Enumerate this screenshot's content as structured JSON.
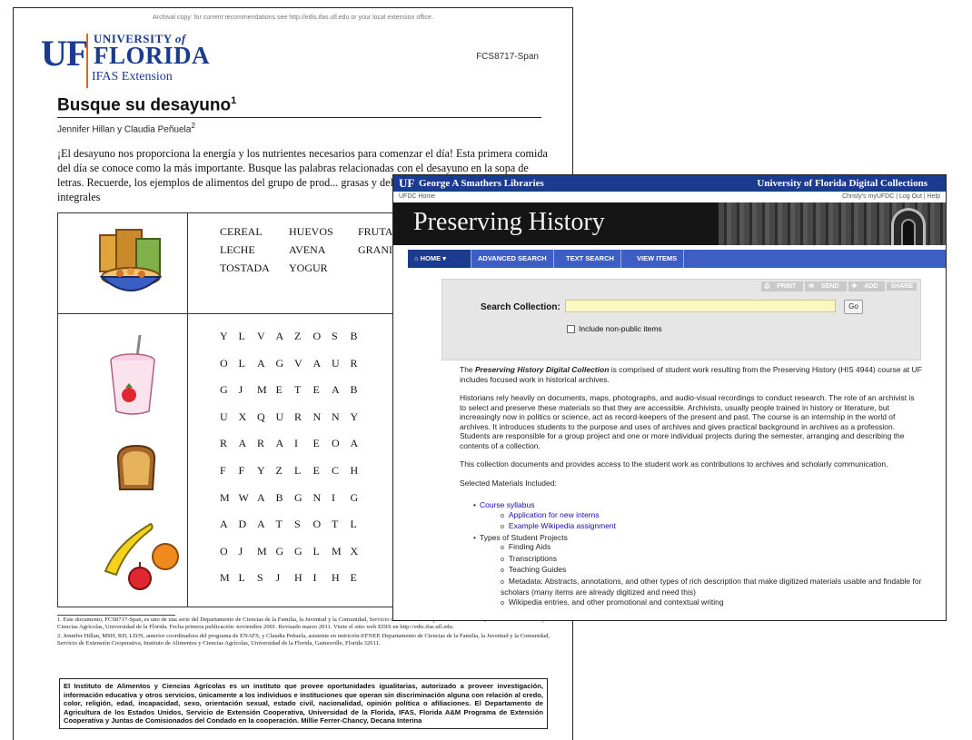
{
  "document": {
    "archival_note": "Archival copy: for current recommendations see http://edis.ifas.ufl.edu or your local extension office.",
    "logo": {
      "uf": "UF",
      "university_of": "UNIVERSITY",
      "of": "of",
      "florida": "FLORIDA",
      "ifas": "IFAS Extension"
    },
    "code": "FCS8717-Span",
    "title": "Busque su desayuno",
    "title_sup": "1",
    "authors": "Jennifer Hillan y Claudia Peñuela",
    "authors_sup": "2",
    "intro": "¡El desayuno nos proporciona la energía y los nutrientes necesarios para comenzar el día! Esta primera comida del día se conoce como la más importante. Busque las palabras relacionadas con el desayuno en la sopa de letras. Recuerde, los ejemplos de alimentos del grupo de prod... grasas y del grupo de granos, granos integrales",
    "words": [
      [
        "CEREAL",
        "HUEVOS",
        "FRUTAS"
      ],
      [
        "LECHE",
        "AVENA",
        "GRANIZ"
      ],
      [
        "TOSTADA",
        "YOGUR",
        ""
      ]
    ],
    "grid": [
      [
        "Y",
        "L",
        "V",
        "A",
        "Z",
        "O",
        "S",
        "B"
      ],
      [
        "O",
        "L",
        "A",
        "G",
        "V",
        "A",
        "U",
        "R"
      ],
      [
        "G",
        "J",
        "M",
        "E",
        "T",
        "E",
        "A",
        "B"
      ],
      [
        "U",
        "X",
        "Q",
        "U",
        "R",
        "N",
        "N",
        "Y"
      ],
      [
        "R",
        "A",
        "R",
        "A",
        "I",
        "E",
        "O",
        "A"
      ],
      [
        "F",
        "F",
        "Y",
        "Z",
        "L",
        "E",
        "C",
        "H"
      ],
      [
        "M",
        "W",
        "A",
        "B",
        "G",
        "N",
        "I",
        "G"
      ],
      [
        "A",
        "D",
        "A",
        "T",
        "S",
        "O",
        "T",
        "L"
      ],
      [
        "O",
        "J",
        "M",
        "G",
        "G",
        "L",
        "M",
        "X"
      ],
      [
        "M",
        "L",
        "S",
        "J",
        "H",
        "I",
        "H",
        "E"
      ]
    ],
    "footnote_1": "1. Este documento, FCS8717-Span, es uno de una serie del Departamento de Ciencias de la Familia, la Juventud y la Comunidad, Servicio de Extensión Cooperativa de la Florida, Instituto de Alimentos y Ciencias Agrícolas, Universidad de la Florida. Fecha primera publicación: noviembre 2001. Revisado marzo 2011. Visite el sitio web EDIS en http://edis.ifas.ufl.edu.",
    "footnote_2": "2. Jennifer Hillan, MSH, RD, LD/N, anterior coordinadora del programa de ENAFS, y Claudia Peñuela, asistente en nutrición-EFNEP, Departamento de Ciencias de la Familia, la Juventud y la Comunidad, Servicio de Extensión Cooperativa, Instituto de Alimentos y Ciencias Agrícolas, Universidad de la Florida, Gainesville, Florida 32611.",
    "ifas_notice": "El Instituto de Alimentos y Ciencias Agrícolas es un instituto que provee oportunidades igualitarias, autorizado a proveer investigación, información educativa y otros servicios, únicamente a los individuos e instituciones que operan sin discriminación alguna con relación al credo, color, religión, edad, incapacidad, sexo, orientación sexual, estado civil, nacionalidad, opinión política o afiliaciones. El Departamento de Agricultura de los Estados Unidos, Servicio de Extensión Cooperativa, Universidad de la Florida, IFAS, Florida A&M Programa de Extensión Cooperativa y Juntas de Comisionados del Condado en la cooperación. Millie Ferrer-Chancy, Decana Interina"
  },
  "browser": {
    "topbar": {
      "uf": "UF",
      "library": "George A Smathers Libraries",
      "collection": "University of Florida Digital Collections"
    },
    "subbar": {
      "home": "UFDC Home",
      "account": "Christy's myUFDC  |  Log Out  |  Help"
    },
    "banner_title": "Preserving History",
    "nav": {
      "home": "HOME",
      "advanced": "ADVANCED SEARCH",
      "text": "TEXT SEARCH",
      "view": "VIEW ITEMS"
    },
    "actions": {
      "print": "PRINT",
      "send": "SEND",
      "add": "ADD",
      "share": "SHARE"
    },
    "search": {
      "label": "Search Collection:",
      "value": "",
      "go": "Go",
      "checkbox_label": "Include non-public items"
    },
    "content": {
      "p1_lead": "The ",
      "p1_em": "Preserving History Digital Collection",
      "p1_rest": " is comprised of student work resulting from the Preserving History (HIS 4944) course at UF includes focused work in historical archives.",
      "p2": "Historians rely heavily on documents, maps, photographs, and audio-visual recordings to conduct research. The role of an archivist is to select and preserve these materials so that they are accessible. Archivists, usually people trained in history or literature, but increasingly now in politics or science, act as record-keepers of the present and past. The course is an internship in the world of archives. It introduces students to the purpose and uses of archives and gives practical background in archives as a profession. Students are responsible for a group project and one or more individual projects during the semester, arranging and describing the contents of a collection.",
      "p3": "This collection documents and provides access to the student work as contributions to archives and scholarly communication.",
      "p4": "Selected Materials Included:",
      "item_syllabus": "Course syllabus",
      "item_interns": "Application for new interns",
      "item_wiki": "Example Wikipedia assignment",
      "item_types": "Types of Student Projects",
      "sub_aids": "Finding Aids",
      "sub_trans": "Transcriptions",
      "sub_teach": "Teaching Guides",
      "sub_meta": "Metadata: Abstracts, annotations, and other types of rich description that make digitized materials usable and findable for scholars (many items are already digitized and need this)",
      "sub_wiki": "Wikipedia entries, and other promotional and contextual writing"
    }
  }
}
